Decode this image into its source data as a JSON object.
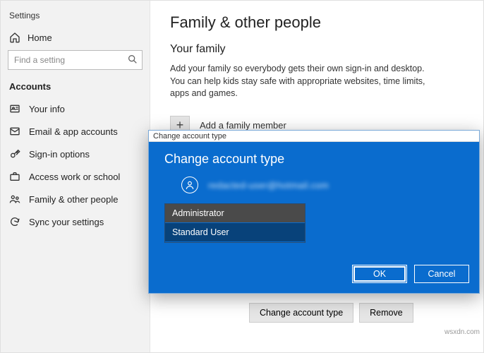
{
  "window_title": "Settings",
  "sidebar": {
    "home_label": "Home",
    "search_placeholder": "Find a setting",
    "section_header": "Accounts",
    "items": [
      {
        "label": "Your info"
      },
      {
        "label": "Email & app accounts"
      },
      {
        "label": "Sign-in options"
      },
      {
        "label": "Access work or school"
      },
      {
        "label": "Family & other people"
      },
      {
        "label": "Sync your settings"
      }
    ]
  },
  "main": {
    "page_title": "Family & other people",
    "section_heading": "Your family",
    "blurb": "Add your family so everybody gets their own sign-in and desktop. You can help kids stay safe with appropriate websites, time limits, apps and games.",
    "add_member_label": "Add a family member",
    "change_btn": "Change account type",
    "remove_btn": "Remove"
  },
  "dialog": {
    "titlebar": "Change account type",
    "heading": "Change account type",
    "email": "redacted-user@hotmail.com",
    "options": [
      "Administrator",
      "Standard User"
    ],
    "ok": "OK",
    "cancel": "Cancel"
  },
  "watermark": "wsxdn.com"
}
